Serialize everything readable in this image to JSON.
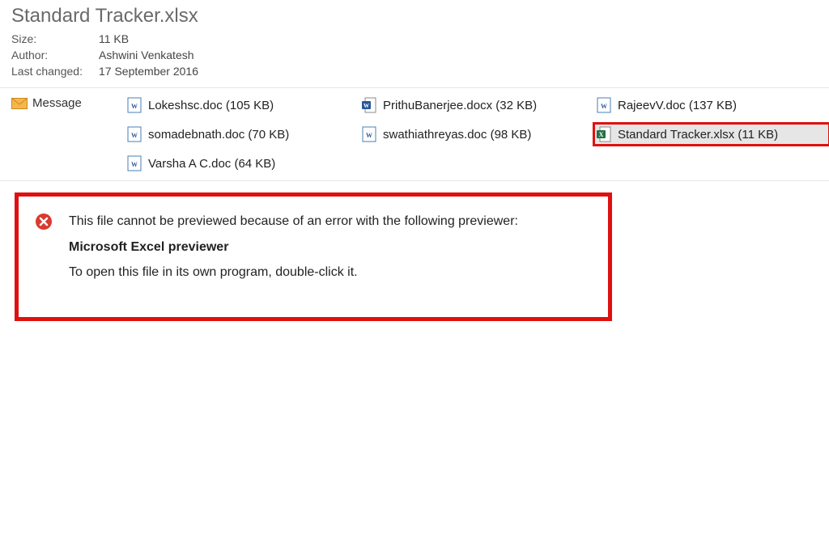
{
  "header": {
    "title": "Standard Tracker.xlsx",
    "meta": [
      {
        "label": "Size:",
        "value": "11 KB"
      },
      {
        "label": "Author:",
        "value": "Ashwini Venkatesh"
      },
      {
        "label": "Last changed:",
        "value": "17 September 2016"
      }
    ]
  },
  "messageLabel": "Message",
  "attachments": [
    {
      "name": "Lokeshsc.doc (105 KB)",
      "icon": "doc"
    },
    {
      "name": "PrithuBanerjee.docx (32 KB)",
      "icon": "docx"
    },
    {
      "name": "RajeevV.doc (137 KB)",
      "icon": "doc"
    },
    {
      "name": "somadebnath.doc (70 KB)",
      "icon": "doc"
    },
    {
      "name": "swathiathreyas.doc (98 KB)",
      "icon": "doc"
    },
    {
      "name": "Standard Tracker.xlsx (11 KB)",
      "icon": "xlsx",
      "selected": true,
      "highlighted": true
    },
    {
      "name": "Varsha A C.doc (64 KB)",
      "icon": "doc"
    }
  ],
  "error": {
    "line1": "This file cannot be previewed because of an error with the following previewer:",
    "previewer": "Microsoft Excel previewer",
    "line2": "To open this file in its own program, double-click it."
  }
}
